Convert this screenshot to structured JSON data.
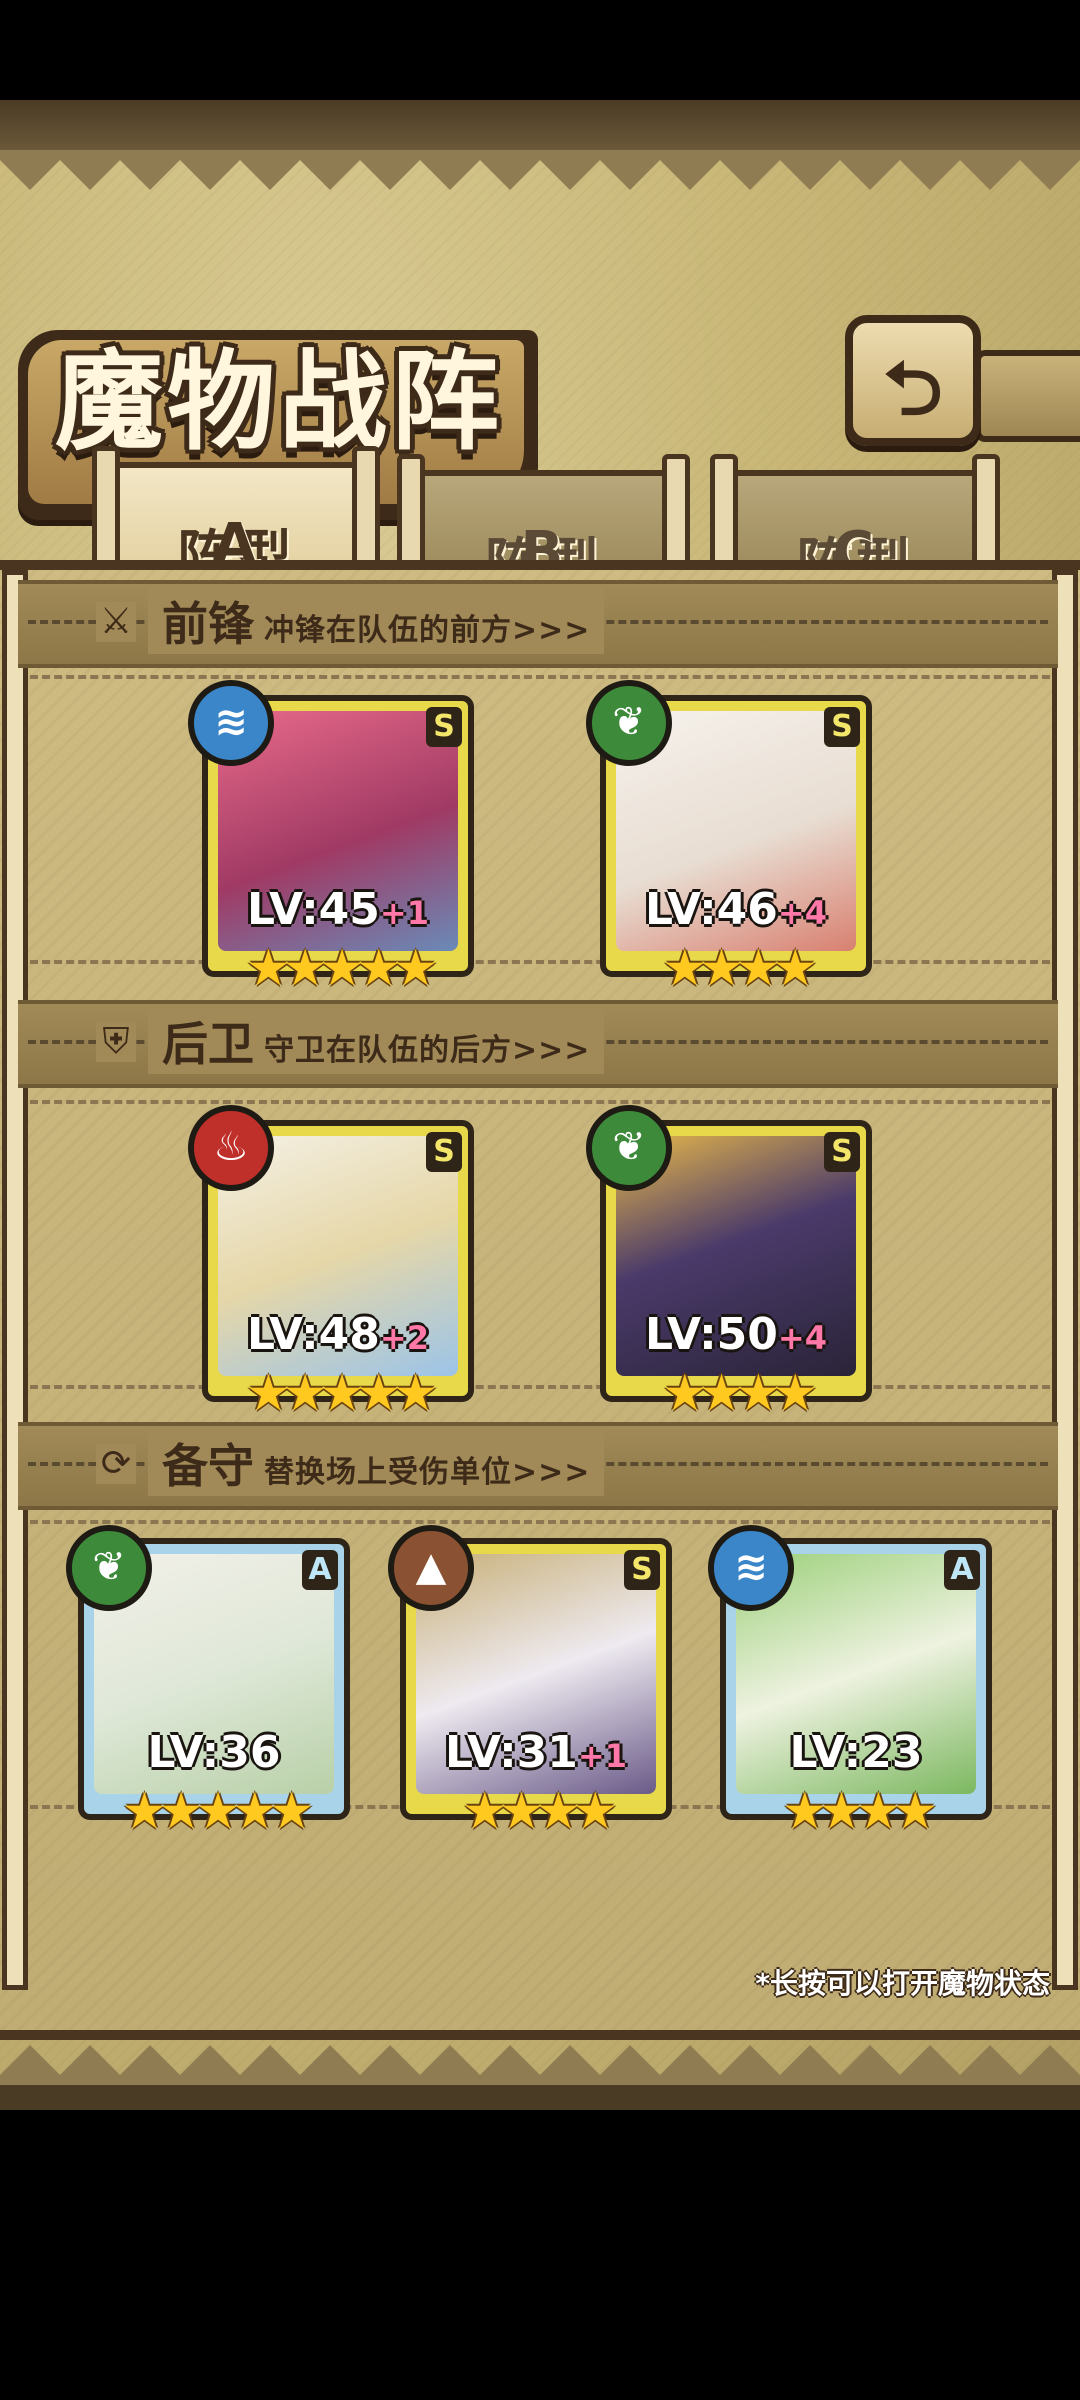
{
  "title": "魔物战阵",
  "back_icon": "return-arrow-icon",
  "tabs": [
    {
      "label": "阵型",
      "letter": "A",
      "active": true
    },
    {
      "label": "阵型",
      "letter": "B",
      "active": false
    },
    {
      "label": "阵型",
      "letter": "C",
      "active": false
    }
  ],
  "sections": {
    "front": {
      "title": "前锋",
      "subtitle": "冲锋在队伍的前方>>>",
      "icon": "sword-icon"
    },
    "rear": {
      "title": "后卫",
      "subtitle": "守卫在队伍的后方>>>",
      "icon": "shield-icon"
    },
    "reserve": {
      "title": "备守",
      "subtitle": "替换场上受伤单位>>>",
      "icon": "swap-icon"
    }
  },
  "front_cards": [
    {
      "level": "LV:45",
      "bonus": "+1",
      "rank": "S",
      "stars": "★★★★★",
      "element": "water"
    },
    {
      "level": "LV:46",
      "bonus": "+4",
      "rank": "S",
      "stars": "★★★★",
      "element": "grass"
    }
  ],
  "rear_cards": [
    {
      "level": "LV:48",
      "bonus": "+2",
      "rank": "S",
      "stars": "★★★★★",
      "element": "fire"
    },
    {
      "level": "LV:50",
      "bonus": "+4",
      "rank": "S",
      "stars": "★★★★",
      "element": "grass"
    }
  ],
  "reserve_cards": [
    {
      "level": "LV:36",
      "bonus": "",
      "rank": "A",
      "stars": "★★★★★",
      "element": "grass"
    },
    {
      "level": "LV:31",
      "bonus": "+1",
      "rank": "S",
      "stars": "★★★★",
      "element": "earth"
    },
    {
      "level": "LV:23",
      "bonus": "",
      "rank": "A",
      "stars": "★★★★",
      "element": "water"
    }
  ],
  "element_glyphs": {
    "water": "≋",
    "grass": "❦",
    "fire": "♨",
    "earth": "▲"
  },
  "hint": "*长按可以打开魔物状态",
  "colors": {
    "frame": "#4a3520",
    "gold_card": "#e8d94a",
    "blue_card": "#a9d3e8",
    "plus_text": "#ff78a8",
    "star": "#ffc91f"
  }
}
